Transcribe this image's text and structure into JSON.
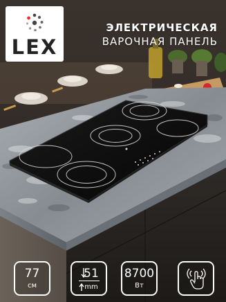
{
  "brand": {
    "logo_text": "LEX",
    "logo_dot_colors": [
      "#e8322d",
      "#444444"
    ]
  },
  "headline": {
    "line1": "ЭЛЕКТРИЧЕСКАЯ",
    "line2": "ВАРОЧНАЯ ПАНЕЛЬ"
  },
  "hob": {
    "color": "#0b0b0b",
    "zone_count": 5
  },
  "features": [
    {
      "icon": "width-icon",
      "value": "77",
      "unit": "см"
    },
    {
      "icon": "depth-icon",
      "value": "51",
      "unit": "mm"
    },
    {
      "icon": "power-icon",
      "value": "8700",
      "unit": "Вт"
    },
    {
      "icon": "touch-control-icon",
      "value": "",
      "unit": ""
    }
  ],
  "colors": {
    "countertop": "#8f9599",
    "cabinet": "#2f2b27",
    "wall": "#3d3530"
  }
}
